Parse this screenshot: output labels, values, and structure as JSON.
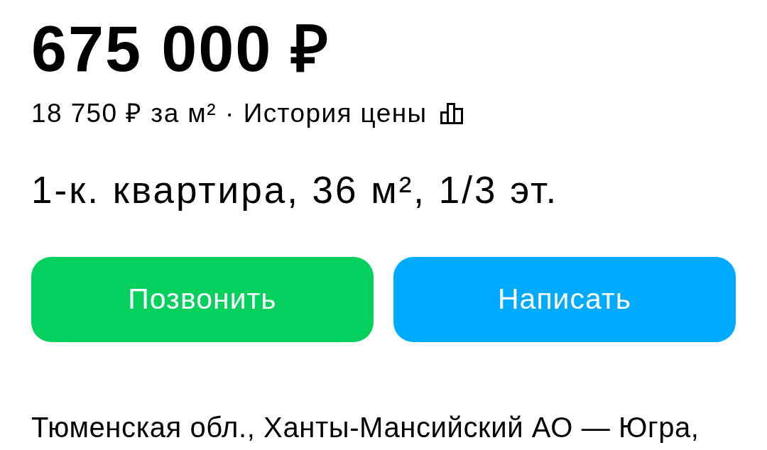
{
  "price": "675 000 ₽",
  "price_per_m2": "18 750 ₽ за м²",
  "separator": "·",
  "price_history": {
    "label": "История цены"
  },
  "title": "1-к. квартира, 36 м², 1/3 эт.",
  "buttons": [
    {
      "label": "Позвонить",
      "kind": "call"
    },
    {
      "label": "Написать",
      "kind": "message"
    }
  ],
  "address": "Тюменская обл., Ханты-Мансийский АО — Югра,"
}
